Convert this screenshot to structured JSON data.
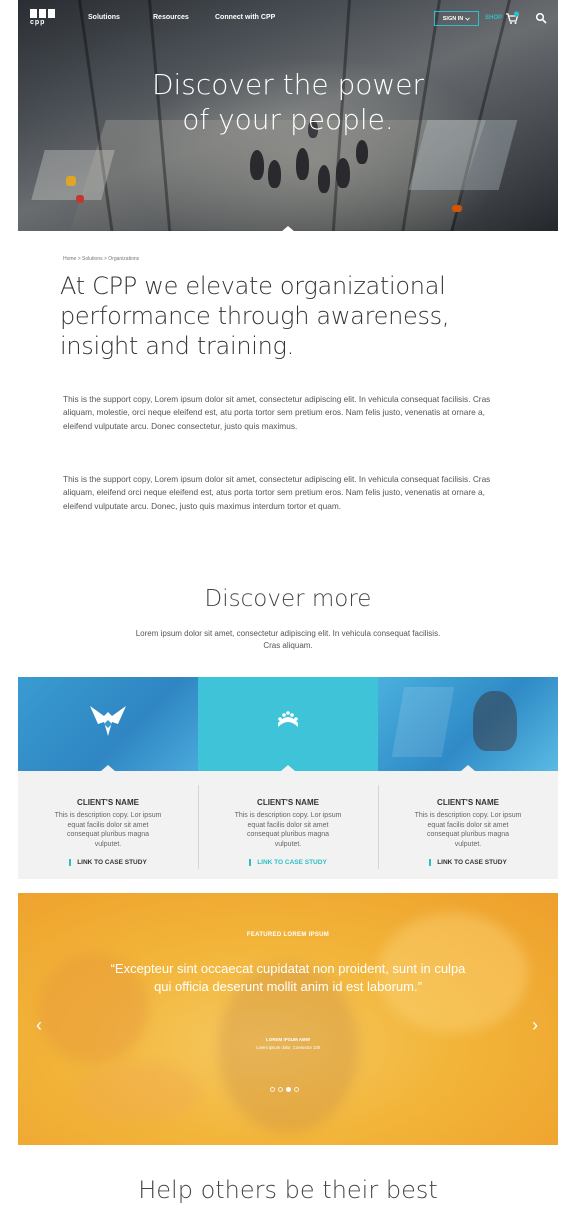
{
  "nav": {
    "logo_text": "cpp",
    "links": [
      "Solutions",
      "Resources",
      "Connect with CPP"
    ],
    "sign_in": "SIGN IN",
    "shop": "SHOP"
  },
  "hero": {
    "line1": "Discover the power",
    "line2": "of your people."
  },
  "breadcrumb": "Home > Solutions > Organizations",
  "headline": "At CPP we elevate organizational performance through awareness, insight and training.",
  "body": {
    "p1": "This is the support copy, Lorem ipsum dolor sit amet, consectetur adipiscing elit. In vehicula consequat facilisis. Cras aliquam, molestie, orci neque eleifend est, atu porta tortor sem pretium eros. Nam felis justo, venenatis at ornare a, eleifend vulputate arcu. Donec consectetur, justo quis maximus.",
    "p2": "This is the support copy, Lorem ipsum dolor sit amet, consectetur adipiscing elit. In vehicula consequat facilisis. Cras aliquam, eleifend orci neque eleifend est, atus porta tortor sem pretium eros. Nam felis justo, venenatis at ornare a, eleifend vulputate arcu. Donec, justo quis maximus interdum tortor et quam."
  },
  "discover": {
    "title": "Discover more",
    "subtitle": "Lorem ipsum dolor sit amet, consectetur adipiscing elit. In vehicula consequat facilisis. Cras aliquam."
  },
  "clients": [
    {
      "name": "CLIENT'S NAME",
      "desc": "This is description copy. Lor ipsum equat facilis dolor sit amet consequat pluribus magna vulputet.",
      "link": "LINK TO CASE STUDY"
    },
    {
      "name": "CLIENT'S NAME",
      "desc": "This is description copy. Lor ipsum equat facilis dolor sit amet consequat pluribus magna vulputet.",
      "link": "LINK TO CASE STUDY"
    },
    {
      "name": "CLIENT'S NAME",
      "desc": "This is description copy. Lor ipsum equat facilis dolor sit amet consequat pluribus magna vulputet.",
      "link": "LINK TO CASE STUDY"
    }
  ],
  "featured": {
    "label": "FEATURED LOREM IPSUM",
    "quote": "“Excepteur sint occaecat cupidatat non proident, sunt in culpa qui officia deserunt mollit anim id est laborum.”",
    "author": "LOREM IPSUM AMW",
    "author_sub": "Lorem ipsum dolor, Consectur 100",
    "prev": "‹",
    "next": "›"
  },
  "help": {
    "title": "Help others be their best"
  },
  "colors": {
    "accent": "#2dbfc6",
    "featured_bg": "#f2b53a",
    "tile_blue": "#3a9bd2",
    "tile_teal": "#3fc3d8"
  }
}
